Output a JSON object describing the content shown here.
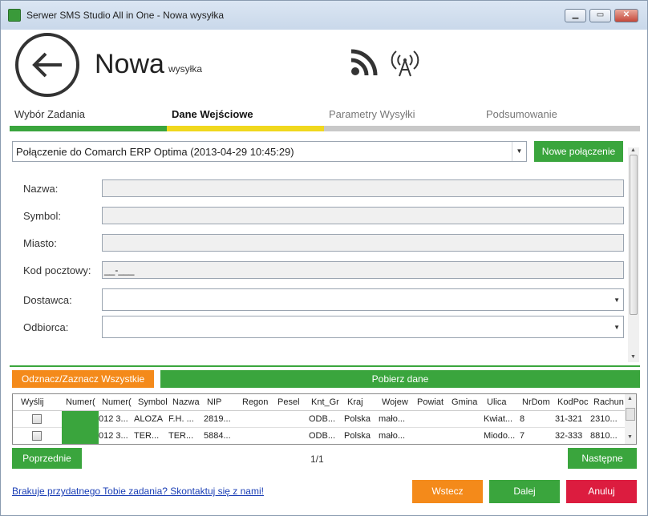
{
  "window": {
    "title": "Serwer SMS Studio All in One - Nowa wysyłka"
  },
  "header": {
    "title": "Nowa",
    "subtitle": "wysyłka"
  },
  "steps": [
    {
      "label": "Wybór Zadania",
      "color": "#3aa53d"
    },
    {
      "label": "Dane Wejściowe",
      "color": "#f0d81e"
    },
    {
      "label": "Parametry Wysyłki",
      "color": "#c8c8c8"
    },
    {
      "label": "Podsumowanie",
      "color": "#c8c8c8"
    }
  ],
  "connection": {
    "selected": "Połączenie do Comarch ERP Optima (2013-04-29 10:45:29)",
    "new_button": "Nowe połączenie"
  },
  "form": {
    "name_label": "Nazwa:",
    "symbol_label": "Symbol:",
    "city_label": "Miasto:",
    "postal_label": "Kod pocztowy:",
    "postal_value": "__-___",
    "supplier_label": "Dostawca:",
    "recipient_label": "Odbiorca:"
  },
  "actions": {
    "toggle_all": "Odznacz/Zaznacz Wszystkie",
    "fetch": "Pobierz dane"
  },
  "grid": {
    "columns": [
      "Wyślij",
      "Numer(",
      "Numer(",
      "Symbol",
      "Nazwa",
      "NIP",
      "Regon",
      "Pesel",
      "Knt_Gr",
      "Kraj",
      "Wojew",
      "Powiat",
      "Gmina",
      "Ulica",
      "NrDom",
      "KodPoc",
      "Rachun"
    ],
    "rows": [
      [
        "",
        "",
        "012 3...",
        "ALOZA",
        "F.H. ...",
        "2819...",
        "",
        "",
        "ODB...",
        "Polska",
        "mało...",
        "",
        "",
        "Kwiat...",
        "8",
        "31-321",
        "2310..."
      ],
      [
        "",
        "",
        "012 3...",
        "TER...",
        "TER...",
        "5884...",
        "",
        "",
        "ODB...",
        "Polska",
        "mało...",
        "",
        "",
        "Miodo...",
        "7",
        "32-333",
        "8810..."
      ]
    ]
  },
  "pager": {
    "prev": "Poprzednie",
    "page": "1/1",
    "next": "Następne"
  },
  "footer": {
    "link": "Brakuje przydatnego Tobie zadania? Skontaktuj się z nami!",
    "back": "Wstecz",
    "next": "Dalej",
    "cancel": "Anuluj"
  },
  "colors": {
    "green": "#3aa53d",
    "orange": "#f48a1a",
    "red": "#dc1c3f",
    "yellow": "#f0d81e"
  }
}
